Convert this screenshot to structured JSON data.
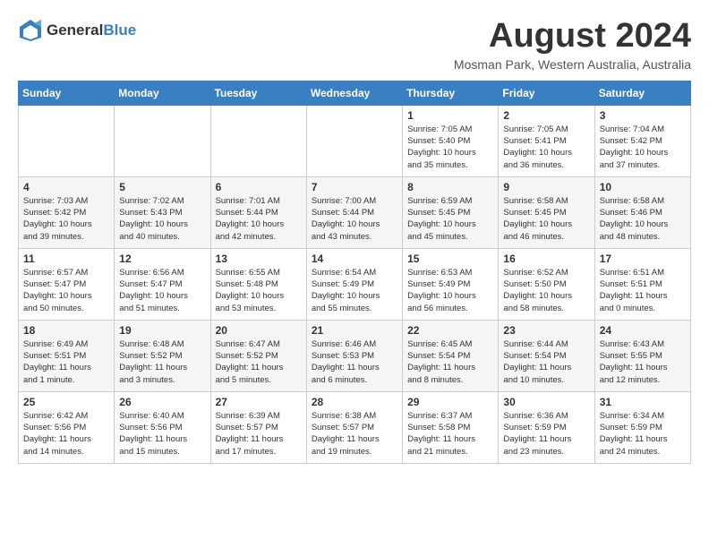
{
  "logo": {
    "text_general": "General",
    "text_blue": "Blue"
  },
  "title": "August 2024",
  "location": "Mosman Park, Western Australia, Australia",
  "days_of_week": [
    "Sunday",
    "Monday",
    "Tuesday",
    "Wednesday",
    "Thursday",
    "Friday",
    "Saturday"
  ],
  "weeks": [
    [
      {
        "num": "",
        "info": ""
      },
      {
        "num": "",
        "info": ""
      },
      {
        "num": "",
        "info": ""
      },
      {
        "num": "",
        "info": ""
      },
      {
        "num": "1",
        "info": "Sunrise: 7:05 AM\nSunset: 5:40 PM\nDaylight: 10 hours\nand 35 minutes."
      },
      {
        "num": "2",
        "info": "Sunrise: 7:05 AM\nSunset: 5:41 PM\nDaylight: 10 hours\nand 36 minutes."
      },
      {
        "num": "3",
        "info": "Sunrise: 7:04 AM\nSunset: 5:42 PM\nDaylight: 10 hours\nand 37 minutes."
      }
    ],
    [
      {
        "num": "4",
        "info": "Sunrise: 7:03 AM\nSunset: 5:42 PM\nDaylight: 10 hours\nand 39 minutes."
      },
      {
        "num": "5",
        "info": "Sunrise: 7:02 AM\nSunset: 5:43 PM\nDaylight: 10 hours\nand 40 minutes."
      },
      {
        "num": "6",
        "info": "Sunrise: 7:01 AM\nSunset: 5:44 PM\nDaylight: 10 hours\nand 42 minutes."
      },
      {
        "num": "7",
        "info": "Sunrise: 7:00 AM\nSunset: 5:44 PM\nDaylight: 10 hours\nand 43 minutes."
      },
      {
        "num": "8",
        "info": "Sunrise: 6:59 AM\nSunset: 5:45 PM\nDaylight: 10 hours\nand 45 minutes."
      },
      {
        "num": "9",
        "info": "Sunrise: 6:58 AM\nSunset: 5:45 PM\nDaylight: 10 hours\nand 46 minutes."
      },
      {
        "num": "10",
        "info": "Sunrise: 6:58 AM\nSunset: 5:46 PM\nDaylight: 10 hours\nand 48 minutes."
      }
    ],
    [
      {
        "num": "11",
        "info": "Sunrise: 6:57 AM\nSunset: 5:47 PM\nDaylight: 10 hours\nand 50 minutes."
      },
      {
        "num": "12",
        "info": "Sunrise: 6:56 AM\nSunset: 5:47 PM\nDaylight: 10 hours\nand 51 minutes."
      },
      {
        "num": "13",
        "info": "Sunrise: 6:55 AM\nSunset: 5:48 PM\nDaylight: 10 hours\nand 53 minutes."
      },
      {
        "num": "14",
        "info": "Sunrise: 6:54 AM\nSunset: 5:49 PM\nDaylight: 10 hours\nand 55 minutes."
      },
      {
        "num": "15",
        "info": "Sunrise: 6:53 AM\nSunset: 5:49 PM\nDaylight: 10 hours\nand 56 minutes."
      },
      {
        "num": "16",
        "info": "Sunrise: 6:52 AM\nSunset: 5:50 PM\nDaylight: 10 hours\nand 58 minutes."
      },
      {
        "num": "17",
        "info": "Sunrise: 6:51 AM\nSunset: 5:51 PM\nDaylight: 11 hours\nand 0 minutes."
      }
    ],
    [
      {
        "num": "18",
        "info": "Sunrise: 6:49 AM\nSunset: 5:51 PM\nDaylight: 11 hours\nand 1 minute."
      },
      {
        "num": "19",
        "info": "Sunrise: 6:48 AM\nSunset: 5:52 PM\nDaylight: 11 hours\nand 3 minutes."
      },
      {
        "num": "20",
        "info": "Sunrise: 6:47 AM\nSunset: 5:52 PM\nDaylight: 11 hours\nand 5 minutes."
      },
      {
        "num": "21",
        "info": "Sunrise: 6:46 AM\nSunset: 5:53 PM\nDaylight: 11 hours\nand 6 minutes."
      },
      {
        "num": "22",
        "info": "Sunrise: 6:45 AM\nSunset: 5:54 PM\nDaylight: 11 hours\nand 8 minutes."
      },
      {
        "num": "23",
        "info": "Sunrise: 6:44 AM\nSunset: 5:54 PM\nDaylight: 11 hours\nand 10 minutes."
      },
      {
        "num": "24",
        "info": "Sunrise: 6:43 AM\nSunset: 5:55 PM\nDaylight: 11 hours\nand 12 minutes."
      }
    ],
    [
      {
        "num": "25",
        "info": "Sunrise: 6:42 AM\nSunset: 5:56 PM\nDaylight: 11 hours\nand 14 minutes."
      },
      {
        "num": "26",
        "info": "Sunrise: 6:40 AM\nSunset: 5:56 PM\nDaylight: 11 hours\nand 15 minutes."
      },
      {
        "num": "27",
        "info": "Sunrise: 6:39 AM\nSunset: 5:57 PM\nDaylight: 11 hours\nand 17 minutes."
      },
      {
        "num": "28",
        "info": "Sunrise: 6:38 AM\nSunset: 5:57 PM\nDaylight: 11 hours\nand 19 minutes."
      },
      {
        "num": "29",
        "info": "Sunrise: 6:37 AM\nSunset: 5:58 PM\nDaylight: 11 hours\nand 21 minutes."
      },
      {
        "num": "30",
        "info": "Sunrise: 6:36 AM\nSunset: 5:59 PM\nDaylight: 11 hours\nand 23 minutes."
      },
      {
        "num": "31",
        "info": "Sunrise: 6:34 AM\nSunset: 5:59 PM\nDaylight: 11 hours\nand 24 minutes."
      }
    ]
  ]
}
